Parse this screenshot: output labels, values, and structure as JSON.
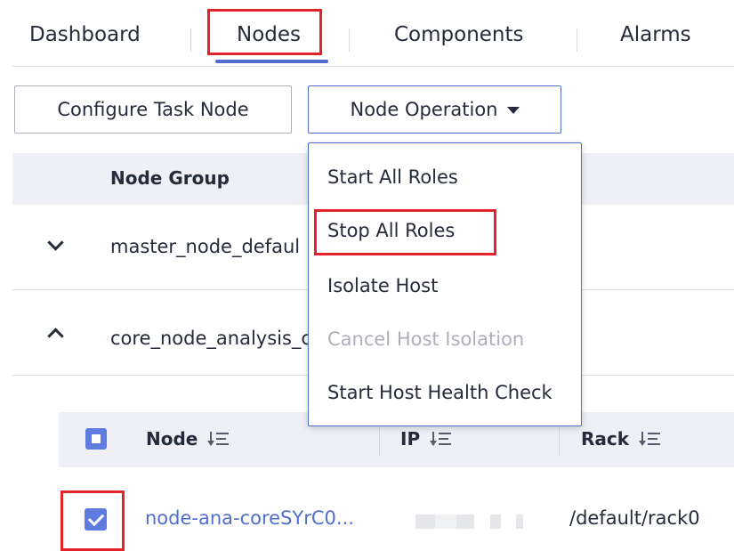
{
  "tabs": [
    {
      "label": "Dashboard",
      "active": false
    },
    {
      "label": "Nodes",
      "active": true
    },
    {
      "label": "Components",
      "active": false
    },
    {
      "label": "Alarms",
      "active": false
    }
  ],
  "toolbar": {
    "configure_label": "Configure Task Node",
    "node_operation_label": "Node Operation"
  },
  "menu": {
    "items": [
      {
        "label": "Start All Roles",
        "enabled": true
      },
      {
        "label": "Stop All Roles",
        "enabled": true
      },
      {
        "label": "Isolate Host",
        "enabled": true
      },
      {
        "label": "Cancel Host Isolation",
        "enabled": false
      },
      {
        "label": "Start Host Health Check",
        "enabled": true
      }
    ]
  },
  "group_table": {
    "header": "Node Group",
    "rows": [
      {
        "name": "master_node_defaul",
        "expanded": false
      },
      {
        "name": "core_node_analysis_c",
        "expanded": true
      }
    ]
  },
  "node_table": {
    "columns": [
      "Node",
      "IP",
      "Rack"
    ],
    "rows": [
      {
        "node": "node-ana-coreSYrC0...",
        "ip": "",
        "rack": "/default/rack0",
        "checked": true
      }
    ]
  },
  "colors": {
    "accent": "#526ecc",
    "checkbox": "#5e7ce0",
    "highlight": "#e2232b",
    "header_bg": "#eef0f5",
    "disabled_text": "#adb0b8"
  }
}
